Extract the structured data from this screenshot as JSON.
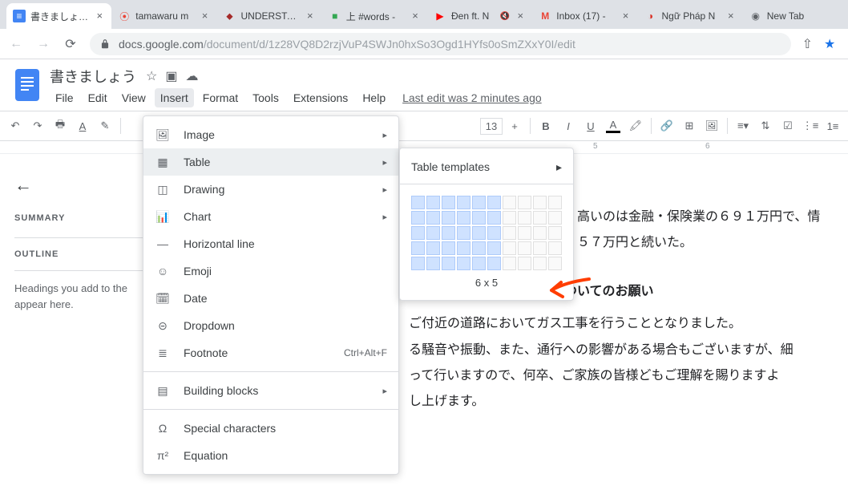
{
  "browser": {
    "tabs": [
      {
        "title": "書きましょう - ",
        "favicon_color": "#4285f4",
        "favicon_bg": "#4285f4",
        "active": true,
        "favicon_text": "≡"
      },
      {
        "title": "tamawaru m",
        "favicon_text": "⦿",
        "favicon_color": "#ea4335"
      },
      {
        "title": "UNDERSTATE",
        "favicon_text": "⬥",
        "favicon_color": "#a52a2a"
      },
      {
        "title": "上 #words - ",
        "favicon_text": "■",
        "favicon_color": "#34a853",
        "muted": true
      },
      {
        "title": "Đen ft. N",
        "favicon_text": "▶",
        "favicon_color": "#ff0000",
        "muted": true
      },
      {
        "title": "Inbox (17) - ",
        "favicon_text": "M",
        "favicon_color": "#ea4335"
      },
      {
        "title": "Ngữ Pháp N",
        "favicon_text": "◑",
        "favicon_color": "#d93025"
      },
      {
        "title": "New Tab",
        "favicon_text": "◉",
        "favicon_color": "#5f6368"
      }
    ],
    "url_host": "docs.google.com",
    "url_path": "/document/d/1z28VQ8D2rzjVuP4SWJn0hxSo3Ogd1HYfs0oSmZXxY0I/edit"
  },
  "docs": {
    "title": "書きましょう",
    "menus": [
      "File",
      "Edit",
      "View",
      "Insert",
      "Format",
      "Tools",
      "Extensions",
      "Help"
    ],
    "open_menu_index": 3,
    "last_edit": "Last edit was 2 minutes ago",
    "font_size": "13",
    "ruler_marks": [
      "5",
      "6"
    ]
  },
  "insert_menu": {
    "items": [
      {
        "label": "Image",
        "icon": "🖼",
        "sub": true
      },
      {
        "label": "Table",
        "icon": "▦",
        "sub": true,
        "highlight": true
      },
      {
        "label": "Drawing",
        "icon": "◫",
        "sub": true
      },
      {
        "label": "Chart",
        "icon": "⫿",
        "sub": true
      },
      {
        "label": "Horizontal line",
        "icon": "—"
      },
      {
        "label": "Emoji",
        "icon": "☺"
      },
      {
        "label": "Date",
        "icon": "🗓"
      },
      {
        "label": "Dropdown",
        "icon": "⊝"
      },
      {
        "label": "Footnote",
        "icon": "≣",
        "shortcut": "Ctrl+Alt+F"
      },
      {
        "label": "Building blocks",
        "icon": "▤",
        "sub": true,
        "sep_before": true
      },
      {
        "label": "Special characters",
        "icon": "Ω",
        "sep_before": true
      },
      {
        "label": "Equation",
        "icon": "π²"
      }
    ]
  },
  "table_submenu": {
    "templates_label": "Table templates",
    "grid_cols": 10,
    "grid_rows": 5,
    "sel_cols": 6,
    "sel_rows": 5,
    "label": "6 x 5"
  },
  "sidebar": {
    "summary": "SUMMARY",
    "outline": "OUTLINE",
    "hint": "Headings you add to the\nappear here."
  },
  "document": {
    "line1": "高いのは金融・保険業の６９１万円で、情",
    "line2": "５７万円と続いた。",
    "heading": "ガス工事についてのお願い",
    "p1": "ご付近の道路においてガス工事を行うこととなりました。",
    "p2": "る騒音や振動、また、通行への影響がある場合もございますが、細",
    "p3": "って行いますので、何卒、ご家族の皆様どもご理解を賜りますよ",
    "p4": "し上げます。"
  }
}
